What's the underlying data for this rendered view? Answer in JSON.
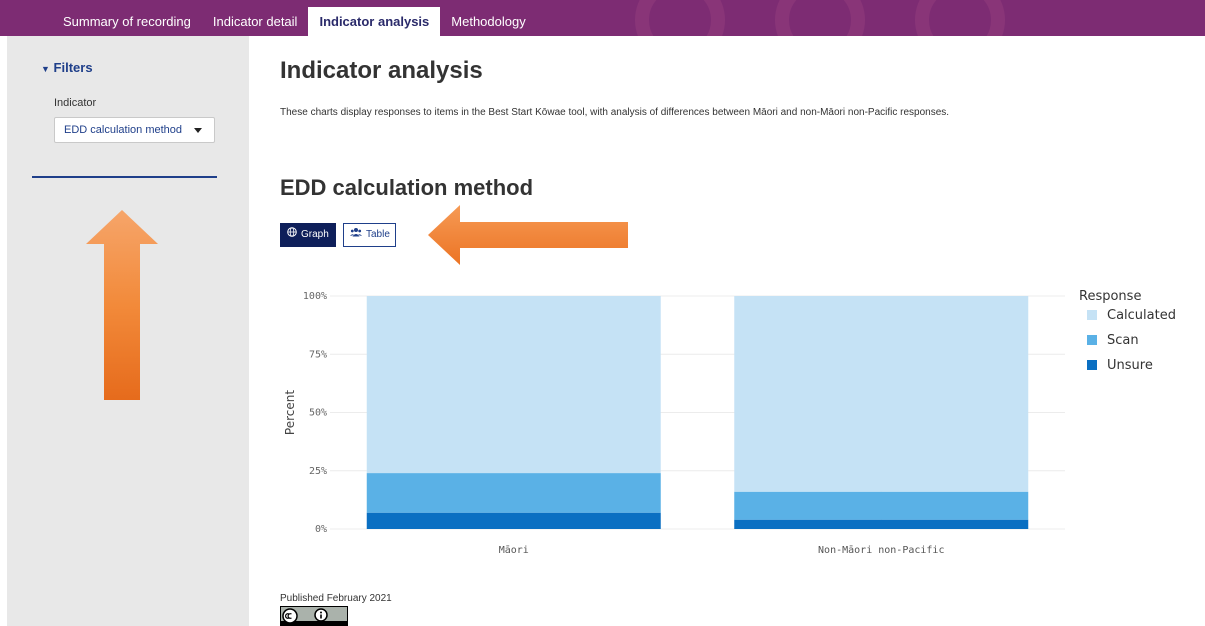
{
  "nav": {
    "tabs": [
      {
        "label": "Summary of recording"
      },
      {
        "label": "Indicator detail"
      },
      {
        "label": "Indicator analysis"
      },
      {
        "label": "Methodology"
      }
    ]
  },
  "sidebar": {
    "filters_label": "Filters",
    "indicator_label": "Indicator",
    "indicator_value": "EDD calculation method"
  },
  "main": {
    "title": "Indicator analysis",
    "intro": "These charts display responses to items in the Best Start Kōwae tool, with analysis of differences between Māori and non-Māori non-Pacific responses.",
    "section_title": "EDD calculation method",
    "view_buttons": {
      "graph": "Graph",
      "table": "Table"
    },
    "published": "Published February 2021"
  },
  "colors": {
    "nav_bg": "#7d2c73",
    "accent": "#1f3f8a",
    "arrow": "#f28a3a"
  },
  "chart_data": {
    "type": "bar",
    "stacked": true,
    "categories": [
      "Māori",
      "Non-Māori non-Pacific"
    ],
    "series": [
      {
        "name": "Unsure",
        "values": [
          7,
          4
        ],
        "color": "#0a6fc2"
      },
      {
        "name": "Scan",
        "values": [
          17,
          12
        ],
        "color": "#5ab1e6"
      },
      {
        "name": "Calculated",
        "values": [
          76,
          84
        ],
        "color": "#c5e2f5"
      }
    ],
    "ylabel": "Percent",
    "ylim": [
      0,
      100
    ],
    "yticks": [
      "0%",
      "25%",
      "50%",
      "75%",
      "100%"
    ],
    "legend_title": "Response",
    "legend_order": [
      "Calculated",
      "Scan",
      "Unsure"
    ],
    "legend_position": "right",
    "grid": true
  }
}
